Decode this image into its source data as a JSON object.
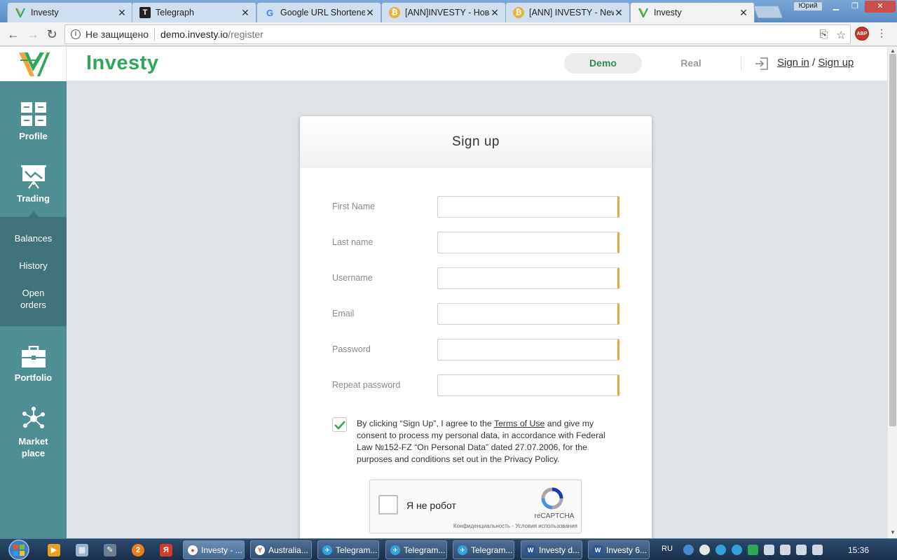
{
  "browser": {
    "tabs": [
      {
        "title": "Investy",
        "icon": "investy-logo-icon",
        "active": false
      },
      {
        "title": "Telegraph",
        "icon": "telegraph-icon",
        "active": false
      },
      {
        "title": "Google URL Shortener",
        "icon": "google-icon",
        "active": false
      },
      {
        "title": "[ANN]INVESTY - Новая",
        "icon": "bitcoin-icon",
        "active": false
      },
      {
        "title": "[ANN] INVESTY - New",
        "icon": "bitcoin-icon",
        "active": false
      },
      {
        "title": "Investy",
        "icon": "investy-logo-icon",
        "active": true
      }
    ],
    "window_user": "Юрий",
    "security_label": "Не защищено",
    "url_host": "demo.investy.io",
    "url_path": "/register",
    "extension_badge": "ABP"
  },
  "header": {
    "brand": "Investy",
    "mode_demo": "Demo",
    "mode_real": "Real",
    "sign_in": "Sign in",
    "auth_separator": " / ",
    "sign_up": "Sign up"
  },
  "sidebar": {
    "profile": "Profile",
    "trading": "Trading",
    "sub": {
      "balances": "Balances",
      "history": "History",
      "open_orders_1": "Open",
      "open_orders_2": "orders"
    },
    "portfolio": "Portfolio",
    "marketplace_1": "Market",
    "marketplace_2": "place"
  },
  "form": {
    "title": "Sign up",
    "fields": [
      {
        "label": "First Name",
        "value": ""
      },
      {
        "label": "Last name",
        "value": ""
      },
      {
        "label": "Username",
        "value": ""
      },
      {
        "label": "Email",
        "value": ""
      },
      {
        "label": "Password",
        "value": ""
      },
      {
        "label": "Repeat password",
        "value": ""
      }
    ],
    "consent_checked": true,
    "consent_prefix": "By clicking “Sign Up”, I agree to the ",
    "consent_link": "Terms of Use",
    "consent_suffix": " and give my consent to process my personal data, in accordance with Federal Law №152-FZ “On Personal Data” dated 27.07.2006, for the purposes and conditions set out in the Privacy Policy.",
    "captcha": {
      "label": "Я не робот",
      "brand": "reCAPTCHA",
      "footer": "Конфиденциальность - Условия использования"
    }
  },
  "taskbar": {
    "buttons": [
      {
        "label": "Investy - ...",
        "icon": "chrome-icon",
        "active": true
      },
      {
        "label": "Australia...",
        "icon": "yandex-browser-icon",
        "active": false
      },
      {
        "label": "Telegram...",
        "icon": "telegram-icon",
        "active": false
      },
      {
        "label": "Telegram...",
        "icon": "telegram-icon",
        "active": false
      },
      {
        "label": "Telegram...",
        "icon": "telegram-icon",
        "active": false
      },
      {
        "label": "Investy d...",
        "icon": "word-icon",
        "active": false
      },
      {
        "label": "Investy 6...",
        "icon": "word-icon",
        "active": false
      }
    ],
    "language": "RU",
    "clock": "15:36"
  },
  "colors": {
    "brand_green": "#2fa65a",
    "sidebar_teal": "#4e8f93",
    "sidebar_sub": "#3e7479",
    "input_accent": "#f0a63c"
  }
}
